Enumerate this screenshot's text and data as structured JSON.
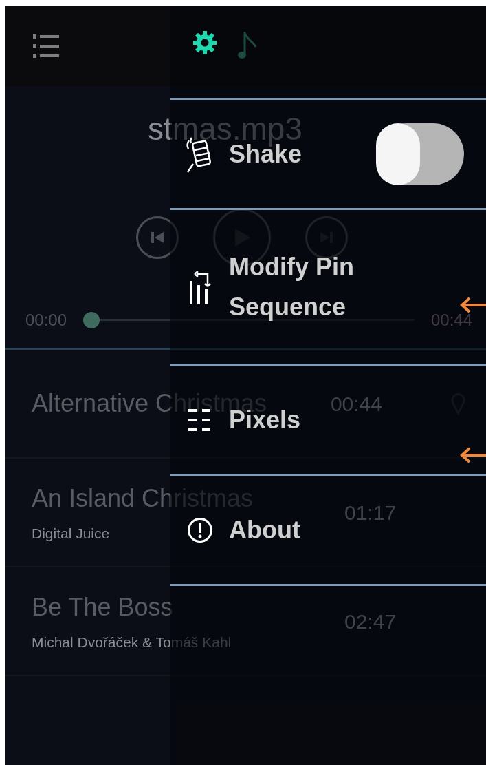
{
  "player": {
    "title": "stmas.mp3",
    "elapsed": "00:00",
    "total": "00:44",
    "level": 0
  },
  "tracks": [
    {
      "title": "Alternative Christmas",
      "duration": "00:44",
      "pinned": true
    },
    {
      "title": "An Island Christmas",
      "artist": "Digital Juice",
      "duration": "01:17",
      "pinned": false
    },
    {
      "title": "Be The Boss",
      "artist": "Michal Dvořáček & Tomáš Kahl",
      "duration": "02:47",
      "pinned": false
    }
  ],
  "drawer": {
    "tabs": [
      {
        "kind": "settings",
        "selected": true
      },
      {
        "kind": "music",
        "selected": false
      }
    ],
    "items": [
      {
        "kind": "shake",
        "label": "Shake",
        "on": false
      },
      {
        "kind": "sequence",
        "label": "Modify Pin Sequence"
      },
      {
        "kind": "pixels",
        "label": "Pixels"
      },
      {
        "kind": "about",
        "label": "About"
      }
    ]
  }
}
